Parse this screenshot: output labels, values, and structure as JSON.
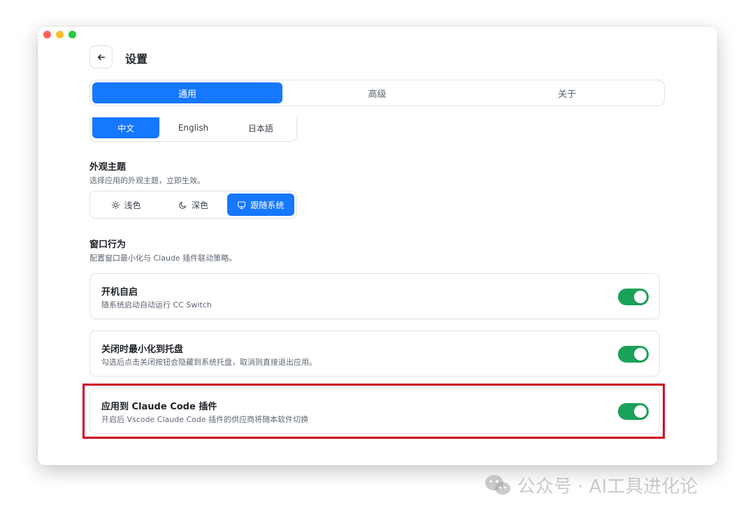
{
  "header": {
    "back_label": "",
    "title": "设置"
  },
  "tabs": [
    {
      "label": "通用",
      "active": true
    },
    {
      "label": "高级",
      "active": false
    },
    {
      "label": "关于",
      "active": false
    }
  ],
  "language": {
    "options": [
      {
        "label": "中文",
        "active": true
      },
      {
        "label": "English",
        "active": false
      },
      {
        "label": "日本語",
        "active": false
      }
    ]
  },
  "appearance": {
    "title": "外观主题",
    "description": "选择应用的外观主题，立即生效。",
    "options": [
      {
        "label": "浅色",
        "icon": "sun-icon",
        "active": false
      },
      {
        "label": "深色",
        "icon": "moon-icon",
        "active": false
      },
      {
        "label": "跟随系统",
        "icon": "monitor-icon",
        "active": true
      }
    ]
  },
  "window_behavior": {
    "title": "窗口行为",
    "description": "配置窗口最小化与 Claude 插件联动策略。",
    "settings": [
      {
        "title": "开机自启",
        "description": "随系统启动自动运行 CC Switch",
        "enabled": true
      },
      {
        "title": "关闭时最小化到托盘",
        "description": "勾选后点击关闭按钮会隐藏到系统托盘，取消则直接退出应用。",
        "enabled": true
      },
      {
        "title": "应用到 Claude Code 插件",
        "description": "开启后 Vscode Claude Code 插件的供应商将随本软件切换",
        "enabled": true
      }
    ]
  },
  "watermark": {
    "text": "公众号 · AI工具进化论"
  },
  "colors": {
    "accent": "#1677ff",
    "toggle_on": "#1aa25a",
    "highlight": "#d0021b"
  }
}
